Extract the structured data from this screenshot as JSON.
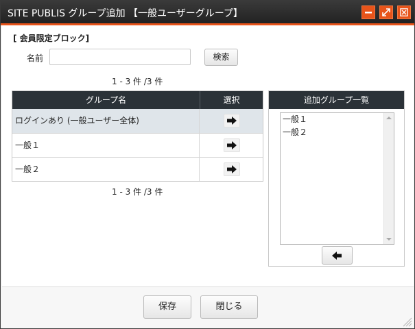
{
  "window": {
    "title": "SITE PUBLIS グループ追加 【一般ユーザーグループ】",
    "accent_color": "#e8541a",
    "controls": [
      "minimize-icon",
      "maximize-icon",
      "close-icon"
    ]
  },
  "search": {
    "section_label": "[ 会員限定ブロック]",
    "name_label": "名前",
    "name_value": "",
    "search_button": "検索"
  },
  "pagination": {
    "top": "1 - 3 件 /3 件",
    "bottom": "1 - 3 件 /3 件"
  },
  "group_table": {
    "headers": {
      "name": "グループ名",
      "select": "選択"
    },
    "rows": [
      {
        "name": "ログインあり (一般ユーザー全体)",
        "action_icon": "arrow-right-icon"
      },
      {
        "name": "一般１",
        "action_icon": "arrow-right-icon"
      },
      {
        "name": "一般２",
        "action_icon": "arrow-right-icon"
      }
    ]
  },
  "added_groups": {
    "header": "追加グループ一覧",
    "items": [
      "一般１",
      "一般２"
    ],
    "remove_icon": "arrow-left-icon"
  },
  "footer": {
    "save_button": "保存",
    "close_button": "閉じる"
  }
}
